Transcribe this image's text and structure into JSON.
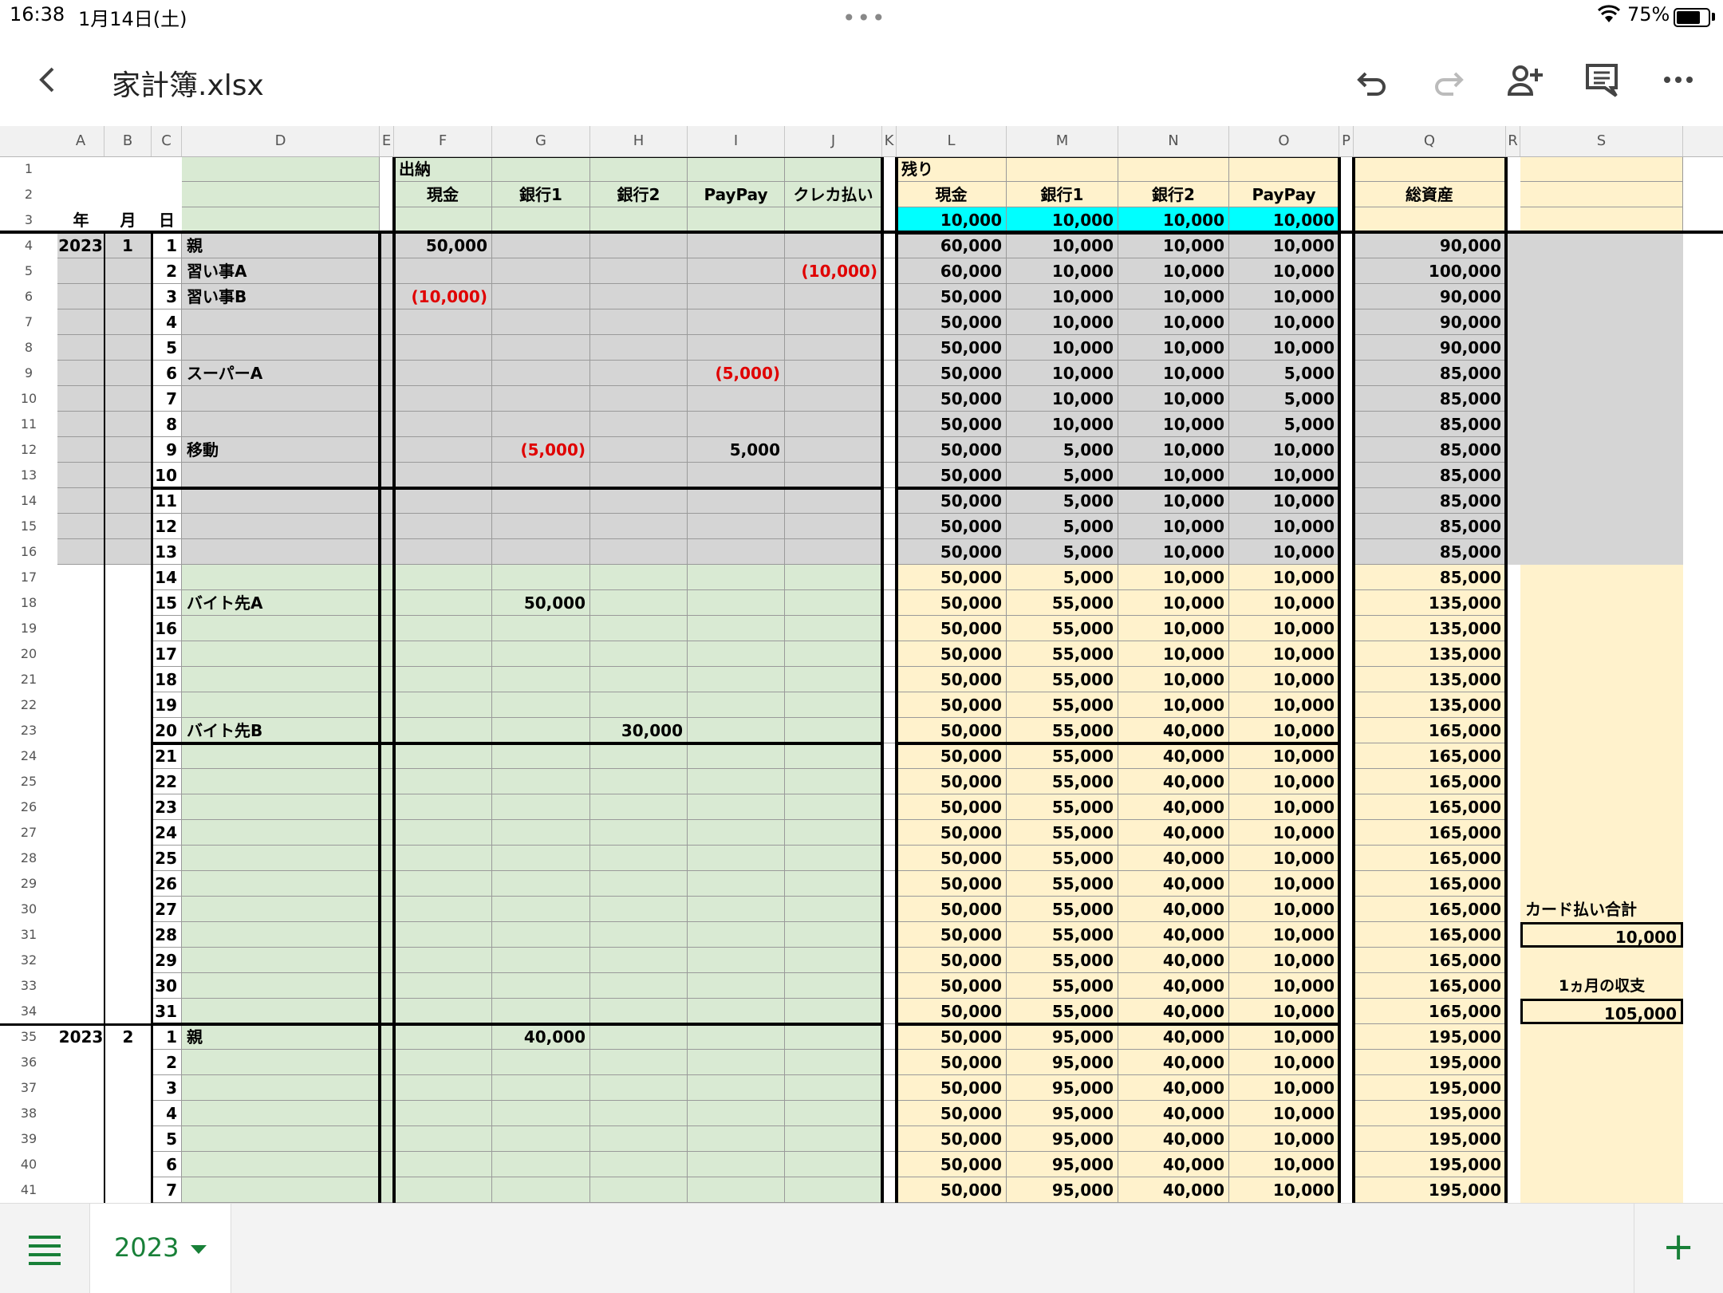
{
  "status": {
    "time": "16:38",
    "date": "1月14日(土)",
    "battery_text": "75%",
    "battery_level": 0.75
  },
  "toolbar": {
    "title": "家計簿.xlsx"
  },
  "icons": [
    "back-icon",
    "undo-icon",
    "redo-icon",
    "add-person-icon",
    "comment-icon",
    "more-icon",
    "menu-icon",
    "add-sheet-icon"
  ],
  "colors": {
    "green": "#d9ead3",
    "yellow": "#fff2cc",
    "gray": "#d5d5d5",
    "cyan": "#00ffff",
    "negative": "#e00000",
    "accent": "#188038"
  },
  "columns": [
    "A",
    "B",
    "C",
    "D",
    "E",
    "F",
    "G",
    "H",
    "I",
    "J",
    "K",
    "L",
    "M",
    "N",
    "O",
    "P",
    "Q",
    "R",
    "S"
  ],
  "row_numbers": [
    "1",
    "2",
    "3",
    "4",
    "5",
    "6",
    "7",
    "8",
    "9",
    "10",
    "11",
    "12",
    "13",
    "14",
    "15",
    "16",
    "17",
    "18",
    "19",
    "20",
    "21",
    "22",
    "23",
    "24",
    "25",
    "26",
    "27",
    "28",
    "29",
    "30",
    "31",
    "32",
    "33",
    "34",
    "35",
    "36",
    "37",
    "38",
    "39",
    "40",
    "41"
  ],
  "headers": {
    "year": "年",
    "month": "月",
    "day": "日",
    "io": "出納",
    "remain": "残り",
    "cash": "現金",
    "bank1": "銀行1",
    "bank2": "銀行2",
    "paypay": "PayPay",
    "credit": "クレカ払い",
    "total": "総資産"
  },
  "start": {
    "cash": "10,000",
    "bank1": "10,000",
    "bank2": "10,000",
    "paypay": "10,000"
  },
  "rows": [
    {
      "y": "2023",
      "m": "1",
      "d": "1",
      "desc": "親",
      "f": "50,000",
      "g": "",
      "h": "",
      "i": "",
      "j": "",
      "l": "60,000",
      "mm": "10,000",
      "n": "10,000",
      "o": "10,000",
      "q": "90,000"
    },
    {
      "y": "",
      "m": "",
      "d": "2",
      "desc": "習い事A",
      "f": "",
      "g": "",
      "h": "",
      "i": "",
      "j": "(10,000)",
      "l": "60,000",
      "mm": "10,000",
      "n": "10,000",
      "o": "10,000",
      "q": "100,000"
    },
    {
      "y": "",
      "m": "",
      "d": "3",
      "desc": "習い事B",
      "f": "(10,000)",
      "g": "",
      "h": "",
      "i": "",
      "j": "",
      "l": "50,000",
      "mm": "10,000",
      "n": "10,000",
      "o": "10,000",
      "q": "90,000"
    },
    {
      "y": "",
      "m": "",
      "d": "4",
      "desc": "",
      "f": "",
      "g": "",
      "h": "",
      "i": "",
      "j": "",
      "l": "50,000",
      "mm": "10,000",
      "n": "10,000",
      "o": "10,000",
      "q": "90,000"
    },
    {
      "y": "",
      "m": "",
      "d": "5",
      "desc": "",
      "f": "",
      "g": "",
      "h": "",
      "i": "",
      "j": "",
      "l": "50,000",
      "mm": "10,000",
      "n": "10,000",
      "o": "10,000",
      "q": "90,000"
    },
    {
      "y": "",
      "m": "",
      "d": "6",
      "desc": "スーパーA",
      "f": "",
      "g": "",
      "h": "",
      "i": "(5,000)",
      "j": "",
      "l": "50,000",
      "mm": "10,000",
      "n": "10,000",
      "o": "5,000",
      "q": "85,000"
    },
    {
      "y": "",
      "m": "",
      "d": "7",
      "desc": "",
      "f": "",
      "g": "",
      "h": "",
      "i": "",
      "j": "",
      "l": "50,000",
      "mm": "10,000",
      "n": "10,000",
      "o": "5,000",
      "q": "85,000"
    },
    {
      "y": "",
      "m": "",
      "d": "8",
      "desc": "",
      "f": "",
      "g": "",
      "h": "",
      "i": "",
      "j": "",
      "l": "50,000",
      "mm": "10,000",
      "n": "10,000",
      "o": "5,000",
      "q": "85,000"
    },
    {
      "y": "",
      "m": "",
      "d": "9",
      "desc": "移動",
      "f": "",
      "g": "(5,000)",
      "h": "",
      "i": "5,000",
      "j": "",
      "l": "50,000",
      "mm": "5,000",
      "n": "10,000",
      "o": "10,000",
      "q": "85,000"
    },
    {
      "y": "",
      "m": "",
      "d": "10",
      "desc": "",
      "f": "",
      "g": "",
      "h": "",
      "i": "",
      "j": "",
      "l": "50,000",
      "mm": "5,000",
      "n": "10,000",
      "o": "10,000",
      "q": "85,000"
    },
    {
      "y": "",
      "m": "",
      "d": "11",
      "desc": "",
      "f": "",
      "g": "",
      "h": "",
      "i": "",
      "j": "",
      "l": "50,000",
      "mm": "5,000",
      "n": "10,000",
      "o": "10,000",
      "q": "85,000"
    },
    {
      "y": "",
      "m": "",
      "d": "12",
      "desc": "",
      "f": "",
      "g": "",
      "h": "",
      "i": "",
      "j": "",
      "l": "50,000",
      "mm": "5,000",
      "n": "10,000",
      "o": "10,000",
      "q": "85,000"
    },
    {
      "y": "",
      "m": "",
      "d": "13",
      "desc": "",
      "f": "",
      "g": "",
      "h": "",
      "i": "",
      "j": "",
      "l": "50,000",
      "mm": "5,000",
      "n": "10,000",
      "o": "10,000",
      "q": "85,000"
    },
    {
      "y": "",
      "m": "",
      "d": "14",
      "desc": "",
      "f": "",
      "g": "",
      "h": "",
      "i": "",
      "j": "",
      "l": "50,000",
      "mm": "5,000",
      "n": "10,000",
      "o": "10,000",
      "q": "85,000"
    },
    {
      "y": "",
      "m": "",
      "d": "15",
      "desc": "バイト先A",
      "f": "",
      "g": "50,000",
      "h": "",
      "i": "",
      "j": "",
      "l": "50,000",
      "mm": "55,000",
      "n": "10,000",
      "o": "10,000",
      "q": "135,000"
    },
    {
      "y": "",
      "m": "",
      "d": "16",
      "desc": "",
      "f": "",
      "g": "",
      "h": "",
      "i": "",
      "j": "",
      "l": "50,000",
      "mm": "55,000",
      "n": "10,000",
      "o": "10,000",
      "q": "135,000"
    },
    {
      "y": "",
      "m": "",
      "d": "17",
      "desc": "",
      "f": "",
      "g": "",
      "h": "",
      "i": "",
      "j": "",
      "l": "50,000",
      "mm": "55,000",
      "n": "10,000",
      "o": "10,000",
      "q": "135,000"
    },
    {
      "y": "",
      "m": "",
      "d": "18",
      "desc": "",
      "f": "",
      "g": "",
      "h": "",
      "i": "",
      "j": "",
      "l": "50,000",
      "mm": "55,000",
      "n": "10,000",
      "o": "10,000",
      "q": "135,000"
    },
    {
      "y": "",
      "m": "",
      "d": "19",
      "desc": "",
      "f": "",
      "g": "",
      "h": "",
      "i": "",
      "j": "",
      "l": "50,000",
      "mm": "55,000",
      "n": "10,000",
      "o": "10,000",
      "q": "135,000"
    },
    {
      "y": "",
      "m": "",
      "d": "20",
      "desc": "バイト先B",
      "f": "",
      "g": "",
      "h": "30,000",
      "i": "",
      "j": "",
      "l": "50,000",
      "mm": "55,000",
      "n": "40,000",
      "o": "10,000",
      "q": "165,000"
    },
    {
      "y": "",
      "m": "",
      "d": "21",
      "desc": "",
      "f": "",
      "g": "",
      "h": "",
      "i": "",
      "j": "",
      "l": "50,000",
      "mm": "55,000",
      "n": "40,000",
      "o": "10,000",
      "q": "165,000"
    },
    {
      "y": "",
      "m": "",
      "d": "22",
      "desc": "",
      "f": "",
      "g": "",
      "h": "",
      "i": "",
      "j": "",
      "l": "50,000",
      "mm": "55,000",
      "n": "40,000",
      "o": "10,000",
      "q": "165,000"
    },
    {
      "y": "",
      "m": "",
      "d": "23",
      "desc": "",
      "f": "",
      "g": "",
      "h": "",
      "i": "",
      "j": "",
      "l": "50,000",
      "mm": "55,000",
      "n": "40,000",
      "o": "10,000",
      "q": "165,000"
    },
    {
      "y": "",
      "m": "",
      "d": "24",
      "desc": "",
      "f": "",
      "g": "",
      "h": "",
      "i": "",
      "j": "",
      "l": "50,000",
      "mm": "55,000",
      "n": "40,000",
      "o": "10,000",
      "q": "165,000"
    },
    {
      "y": "",
      "m": "",
      "d": "25",
      "desc": "",
      "f": "",
      "g": "",
      "h": "",
      "i": "",
      "j": "",
      "l": "50,000",
      "mm": "55,000",
      "n": "40,000",
      "o": "10,000",
      "q": "165,000"
    },
    {
      "y": "",
      "m": "",
      "d": "26",
      "desc": "",
      "f": "",
      "g": "",
      "h": "",
      "i": "",
      "j": "",
      "l": "50,000",
      "mm": "55,000",
      "n": "40,000",
      "o": "10,000",
      "q": "165,000"
    },
    {
      "y": "",
      "m": "",
      "d": "27",
      "desc": "",
      "f": "",
      "g": "",
      "h": "",
      "i": "",
      "j": "",
      "l": "50,000",
      "mm": "55,000",
      "n": "40,000",
      "o": "10,000",
      "q": "165,000"
    },
    {
      "y": "",
      "m": "",
      "d": "28",
      "desc": "",
      "f": "",
      "g": "",
      "h": "",
      "i": "",
      "j": "",
      "l": "50,000",
      "mm": "55,000",
      "n": "40,000",
      "o": "10,000",
      "q": "165,000"
    },
    {
      "y": "",
      "m": "",
      "d": "29",
      "desc": "",
      "f": "",
      "g": "",
      "h": "",
      "i": "",
      "j": "",
      "l": "50,000",
      "mm": "55,000",
      "n": "40,000",
      "o": "10,000",
      "q": "165,000"
    },
    {
      "y": "",
      "m": "",
      "d": "30",
      "desc": "",
      "f": "",
      "g": "",
      "h": "",
      "i": "",
      "j": "",
      "l": "50,000",
      "mm": "55,000",
      "n": "40,000",
      "o": "10,000",
      "q": "165,000"
    },
    {
      "y": "",
      "m": "",
      "d": "31",
      "desc": "",
      "f": "",
      "g": "",
      "h": "",
      "i": "",
      "j": "",
      "l": "50,000",
      "mm": "55,000",
      "n": "40,000",
      "o": "10,000",
      "q": "165,000"
    },
    {
      "y": "2023",
      "m": "2",
      "d": "1",
      "desc": "親",
      "f": "",
      "g": "40,000",
      "h": "",
      "i": "",
      "j": "",
      "l": "50,000",
      "mm": "95,000",
      "n": "40,000",
      "o": "10,000",
      "q": "195,000"
    },
    {
      "y": "",
      "m": "",
      "d": "2",
      "desc": "",
      "f": "",
      "g": "",
      "h": "",
      "i": "",
      "j": "",
      "l": "50,000",
      "mm": "95,000",
      "n": "40,000",
      "o": "10,000",
      "q": "195,000"
    },
    {
      "y": "",
      "m": "",
      "d": "3",
      "desc": "",
      "f": "",
      "g": "",
      "h": "",
      "i": "",
      "j": "",
      "l": "50,000",
      "mm": "95,000",
      "n": "40,000",
      "o": "10,000",
      "q": "195,000"
    },
    {
      "y": "",
      "m": "",
      "d": "4",
      "desc": "",
      "f": "",
      "g": "",
      "h": "",
      "i": "",
      "j": "",
      "l": "50,000",
      "mm": "95,000",
      "n": "40,000",
      "o": "10,000",
      "q": "195,000"
    },
    {
      "y": "",
      "m": "",
      "d": "5",
      "desc": "",
      "f": "",
      "g": "",
      "h": "",
      "i": "",
      "j": "",
      "l": "50,000",
      "mm": "95,000",
      "n": "40,000",
      "o": "10,000",
      "q": "195,000"
    },
    {
      "y": "",
      "m": "",
      "d": "6",
      "desc": "",
      "f": "",
      "g": "",
      "h": "",
      "i": "",
      "j": "",
      "l": "50,000",
      "mm": "95,000",
      "n": "40,000",
      "o": "10,000",
      "q": "195,000"
    },
    {
      "y": "",
      "m": "",
      "d": "7",
      "desc": "",
      "f": "",
      "g": "",
      "h": "",
      "i": "",
      "j": "",
      "l": "50,000",
      "mm": "95,000",
      "n": "40,000",
      "o": "10,000",
      "q": "195,000"
    }
  ],
  "summary": {
    "card_label": "カード払い合計",
    "card_value": "10,000",
    "month_label": "1ヵ月の収支",
    "month_value": "105,000"
  },
  "sheet_tab": {
    "name": "2023"
  }
}
